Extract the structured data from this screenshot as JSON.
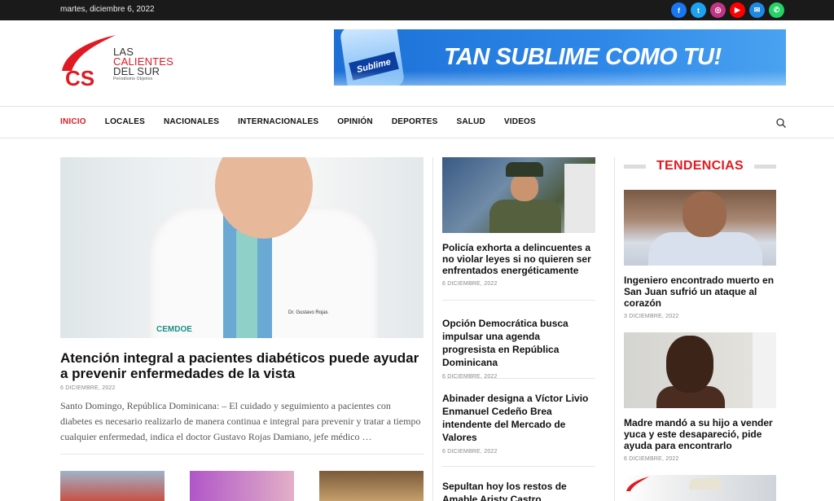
{
  "topbar": {
    "date": "martes, diciembre 6, 2022",
    "social": [
      {
        "icon": "facebook-icon",
        "glyph": "f",
        "color": "#1877f2"
      },
      {
        "icon": "twitter-icon",
        "glyph": "t",
        "color": "#1da1f2"
      },
      {
        "icon": "instagram-icon",
        "glyph": "◎",
        "color": "#c13584"
      },
      {
        "icon": "youtube-icon",
        "glyph": "▶",
        "color": "#ff0000"
      },
      {
        "icon": "email-icon",
        "glyph": "✉",
        "color": "#1e88e5"
      },
      {
        "icon": "whatsapp-icon",
        "glyph": "✆",
        "color": "#25d366"
      }
    ]
  },
  "logo": {
    "line1": "LAS",
    "line2": "CALIENTES",
    "line3": "DEL SUR",
    "tagline": "Periodismo Objetivo",
    "mark": "CS"
  },
  "banner": {
    "slogan": "TAN SUBLIME COMO TU!",
    "brand": "Sublime"
  },
  "nav": {
    "items": [
      "INICIO",
      "LOCALES",
      "NACIONALES",
      "INTERNACIONALES",
      "OPINIÓN",
      "DEPORTES",
      "SALUD",
      "VIDEOS"
    ],
    "active": "INICIO"
  },
  "hero": {
    "title": "Atención integral a pacientes diabéticos puede ayudar a prevenir enfermedades de la vista",
    "date": "6 DICIEMBRE, 2022",
    "excerpt": "Santo Domingo, República Dominicana: – El cuidado y seguimiento a pacientes con diabetes es necesario realizarlo de manera continua e integral para prevenir y tratar a tiempo cualquier enfermedad, indica el doctor Gustavo Rojas Damiano, jefe médico …",
    "image_badge": "CEMDOE",
    "image_tag": "Dr. Gustavo Rojas"
  },
  "middle": {
    "articles": [
      {
        "title": "Policía exhorta a delincuentes a no violar leyes si no quieren ser enfrentados energéticamente",
        "date": "6 DICIEMBRE, 2022"
      },
      {
        "title": "Opción Democrática busca impulsar una agenda progresista en República Dominicana",
        "date": "6 DICIEMBRE, 2022"
      },
      {
        "title": "Abinader designa a Víctor Livio Enmanuel Cedeño Brea intendente del Mercado de Valores",
        "date": "6 DICIEMBRE, 2022"
      },
      {
        "title": "Sepultan hoy los restos de Amable Aristy Castro",
        "date": ""
      }
    ]
  },
  "trending": {
    "heading": "TENDENCIAS",
    "articles": [
      {
        "title": "Ingeniero encontrado muerto en San Juan sufrió un ataque al corazón",
        "date": "3 DICIEMBRE, 2022"
      },
      {
        "title": "Madre mandó a su hijo a vender yuca y este desapareció, pide ayuda para encontrarlo",
        "date": "6 DICIEMBRE, 2022"
      }
    ]
  },
  "colors": {
    "accent": "#e01a22",
    "topbar": "#1a1a1a"
  }
}
